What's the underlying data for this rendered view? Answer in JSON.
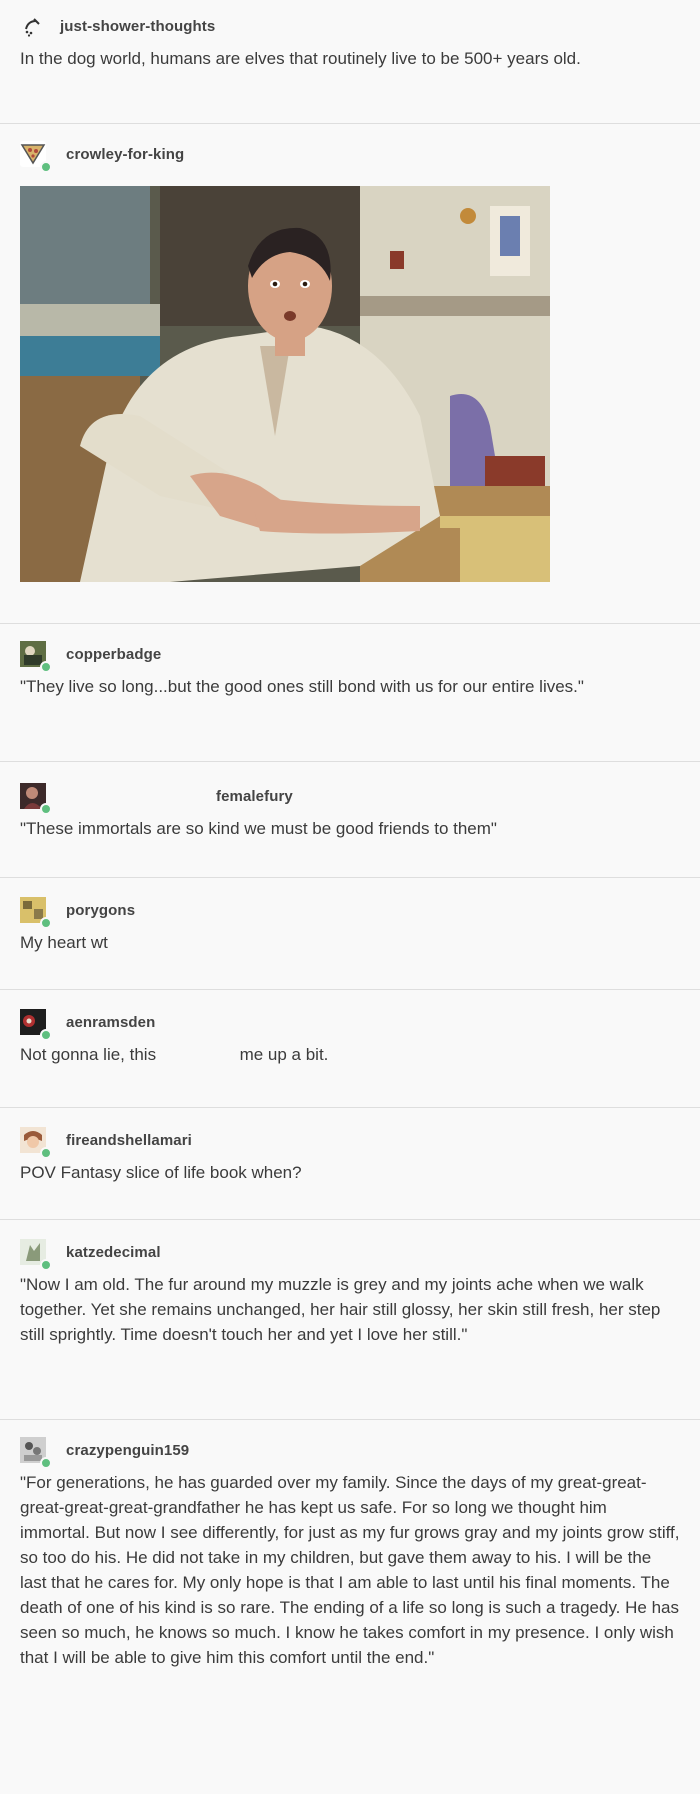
{
  "posts": [
    {
      "username": "just-shower-thoughts",
      "icon": "shower-icon",
      "text": "In the dog world, humans are elves that routinely live to be 500+ years old."
    },
    {
      "username": "crowley-for-king",
      "icon": "avatar-pizza",
      "image": "reaction-gif-man-at-kitchen-table"
    },
    {
      "username": "copperbadge",
      "text": "\"They live so long...but the good ones still bond with us for our entire lives.\""
    },
    {
      "username": "femalefury",
      "text": "\"These immortals are so kind we must be good friends to them\""
    },
    {
      "username": "porygons",
      "text": "My heart wt"
    },
    {
      "username": "aenramsden",
      "text_before": "Not gonna lie, this",
      "text_after": "me up a bit."
    },
    {
      "username": "fireandshellamari",
      "text": "POV Fantasy slice of life book when?"
    },
    {
      "username": "katzedecimal",
      "text": "\"Now I am old. The fur around my muzzle is grey and my joints ache when we walk together. Yet she remains unchanged, her hair still glossy, her skin still fresh, her step still sprightly. Time doesn't touch her and yet I love her still.\""
    },
    {
      "username": "crazypenguin159",
      "text": "\"For generations, he has guarded over my family. Since the days of my great-great-great-great-great-grandfather he has kept us safe. For so long we thought him immortal. But now I see differently, for just as my fur grows gray and my joints grow stiff, so too do his. He did not take in my children, but gave them away to his. I will be the last that he cares for. My only hope is that I am able to last until his final moments. The death of one of his kind is so rare. The ending of a life so long is such a tragedy. He has seen so much, he knows so much. I know he takes comfort in my presence. I only wish that I will be able to give him this comfort until the end.\""
    }
  ],
  "colors": {
    "background": "#f9f9f9",
    "text": "#3b3b3b",
    "badge": "#5fbf7f",
    "divider": "#dedede"
  }
}
